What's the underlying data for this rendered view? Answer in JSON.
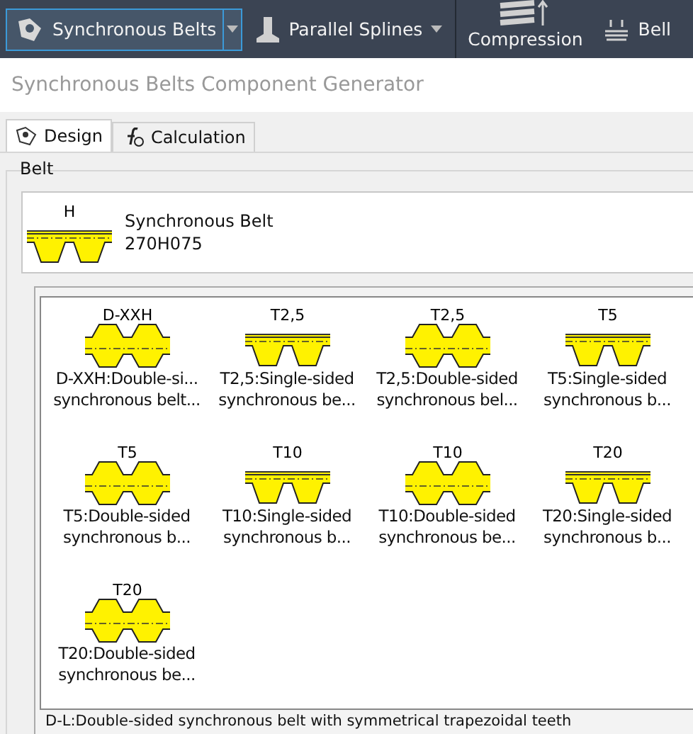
{
  "toolbar": {
    "items": [
      {
        "kind": "split",
        "label": "Synchronous Belts",
        "selected": true
      },
      {
        "kind": "dropdown",
        "label": "Parallel Splines",
        "selected": false
      },
      {
        "kind": "large",
        "label": "Compression",
        "selected": false
      },
      {
        "kind": "plain",
        "label": "Bell",
        "selected": false
      }
    ]
  },
  "window": {
    "title": "Synchronous Belts Component Generator"
  },
  "tabs": [
    {
      "label": "Design",
      "selected": true
    },
    {
      "label": "Calculation",
      "selected": false
    }
  ],
  "belt_group": {
    "title": "Belt",
    "current": {
      "kind": "single",
      "code": "H",
      "name": "Synchronous Belt",
      "designation": "270H075"
    }
  },
  "belt_list": [
    {
      "kind": "double",
      "code": "D-XXH",
      "caption": [
        "D-XXH:Double-si...",
        "synchronous belt..."
      ]
    },
    {
      "kind": "single",
      "code": "T2,5",
      "caption": [
        "T2,5:Single-sided",
        "synchronous be..."
      ]
    },
    {
      "kind": "double",
      "code": "T2,5",
      "caption": [
        "T2,5:Double-sided",
        "synchronous bel..."
      ]
    },
    {
      "kind": "single",
      "code": "T5",
      "caption": [
        "T5:Single-sided",
        "synchronous b..."
      ]
    },
    {
      "kind": "double",
      "code": "T5",
      "caption": [
        "T5:Double-sided",
        "synchronous b..."
      ]
    },
    {
      "kind": "single",
      "code": "T10",
      "caption": [
        "T10:Single-sided",
        "synchronous b..."
      ]
    },
    {
      "kind": "double",
      "code": "T10",
      "caption": [
        "T10:Double-sided",
        "synchronous be..."
      ]
    },
    {
      "kind": "single",
      "code": "T20",
      "caption": [
        "T20:Single-sided",
        "synchronous b..."
      ]
    },
    {
      "kind": "double",
      "code": "T20",
      "caption": [
        "T20:Double-sided",
        "synchronous be..."
      ]
    }
  ],
  "description": "D-L:Double-sided synchronous belt with symmetrical trapezoidal teeth"
}
